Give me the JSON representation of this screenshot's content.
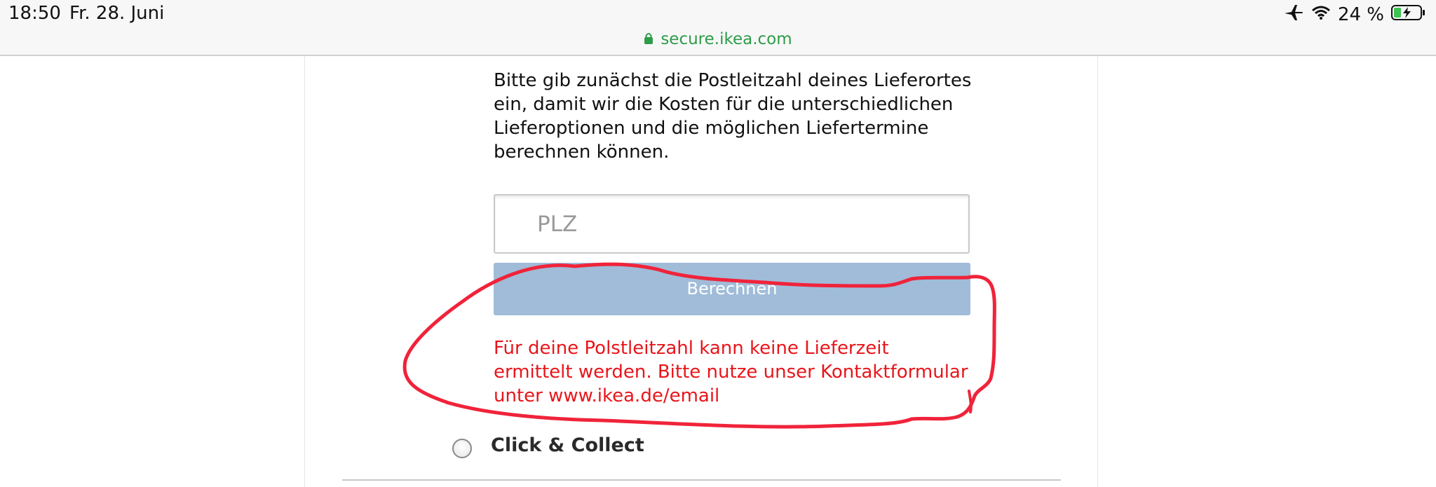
{
  "status_bar": {
    "time": "18:50",
    "date": "Fr. 28. Juni",
    "battery": "24 %",
    "icons": [
      "airplane-icon",
      "wifi-icon",
      "battery-charging-icon"
    ]
  },
  "address_bar": {
    "url": "secure.ikea.com",
    "icon": "lock-icon",
    "color": "#2e9c48"
  },
  "main": {
    "intro_text": "Bitte gib zunächst die Postleitzahl deines Lieferortes ein, damit wir die Kosten für die unterschiedlichen Lieferoptionen und die möglichen Liefertermine berechnen können.",
    "postcode_input": {
      "placeholder": "PLZ",
      "value": ""
    },
    "calculate_button": {
      "label": "Berechnen",
      "color": "#a0bcd9"
    },
    "error_message": "Für deine Polstleitzahl kann keine Lieferzeit ermittelt werden. Bitte nutze unser Kontaktformular unter www.ikea.de/email",
    "error_color": "#e8151a",
    "delivery_option": {
      "label": "Click & Collect",
      "selected": false
    }
  },
  "annotation": {
    "shape": "hand-drawn-ellipse",
    "color": "#f0233a"
  }
}
